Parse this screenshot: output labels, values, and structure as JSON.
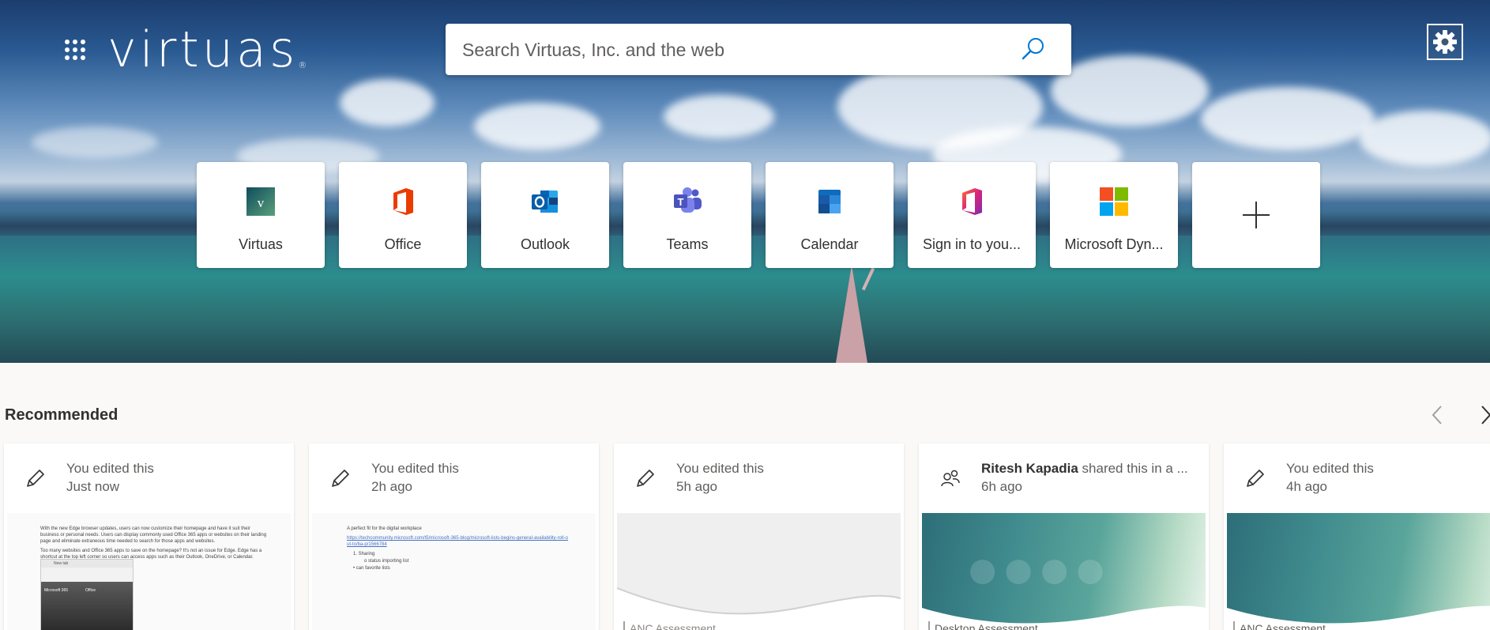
{
  "header": {
    "logo_text": "virtuas",
    "logo_mark": "®",
    "search": {
      "placeholder": "Search Virtuas, Inc. and the web"
    }
  },
  "tiles": [
    {
      "label": "Virtuas",
      "icon": "virtuas-logo-icon"
    },
    {
      "label": "Office",
      "icon": "office-icon"
    },
    {
      "label": "Outlook",
      "icon": "outlook-icon"
    },
    {
      "label": "Teams",
      "icon": "teams-icon"
    },
    {
      "label": "Calendar",
      "icon": "calendar-icon"
    },
    {
      "label": "Sign in to you...",
      "icon": "office-signin-icon"
    },
    {
      "label": "Microsoft Dyn...",
      "icon": "microsoft-icon"
    }
  ],
  "recommended": {
    "title": "Recommended",
    "cards": [
      {
        "line1": "You edited this",
        "line2": "Just now",
        "icon": "pencil-icon",
        "preview": {
          "p1": "With the new Edge browser updates, users can now customize their homepage and have it suit their business or personal needs. Users can display commonly used Office 365 apps or websites on their landing page and eliminate extraneous time needed to search for those apps and websites.",
          "p2": "Too many websites and Office 365 apps to save on the homepage? It's not an issue for Edge. Edge has a shortcut at the top left corner so users can access apps such as their Outlook, OneDrive, or Calendar.",
          "shot_bar": "New tab",
          "shot_label": "Microsoft 365",
          "shot_label2": "Office"
        }
      },
      {
        "line1": "You edited this",
        "line2": "2h ago",
        "icon": "pencil-icon",
        "preview": {
          "heading": "A perfect fit for the digital workplace",
          "link": "https://techcommunity.microsoft.com/t5/microsoft-365-blog/microsoft-lists-begins-general-availability-roll-out-to/ba-p/1566784",
          "item1": "1.   Sharing",
          "item1a": "o   status importing list",
          "item2": "•   can favorite lists"
        }
      },
      {
        "line1": "You edited this",
        "line2": "5h ago",
        "icon": "pencil-icon",
        "preview": {
          "caption": "ANC Assessment"
        }
      },
      {
        "line1_bold": "Ritesh Kapadia",
        "line1": " shared this in a ...",
        "line2": "6h ago",
        "icon": "people-icon",
        "preview": {
          "caption": "Desktop Assessment"
        }
      },
      {
        "line1": "You edited this",
        "line2": "4h ago",
        "icon": "pencil-icon",
        "preview": {
          "caption": "ANC Assessment"
        }
      }
    ]
  },
  "colors": {
    "accent": "#0078d4",
    "office_red": "#eb3c00",
    "teams_purple": "#5059c9"
  }
}
